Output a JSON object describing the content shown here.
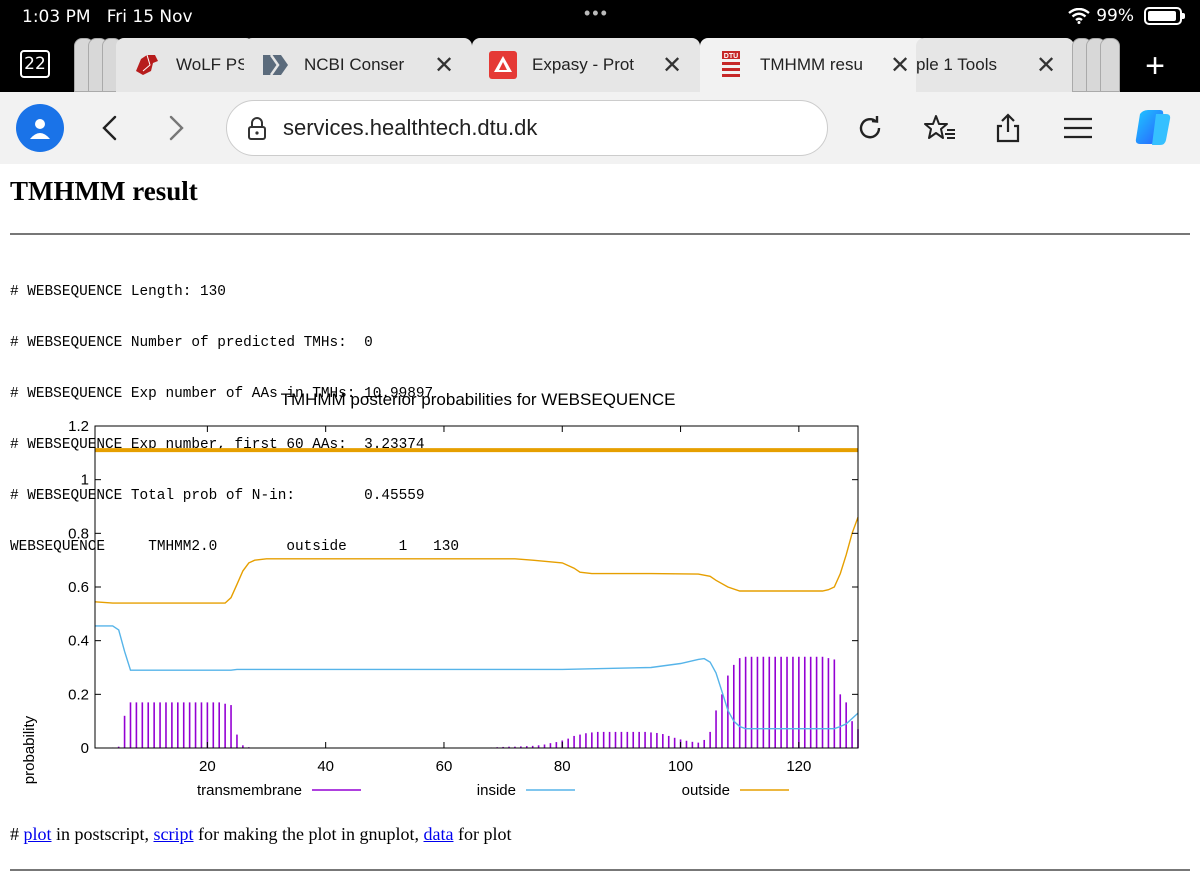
{
  "status_bar": {
    "time": "1:03 PM",
    "date": "Fri 15 Nov",
    "battery": "99%"
  },
  "tabs": {
    "count": "22",
    "items": [
      {
        "title": "WoLF PS",
        "icon": "wolf-icon"
      },
      {
        "title": "NCBI Conser",
        "icon": "ncbi-icon"
      },
      {
        "title": "Expasy - Prot",
        "icon": "expasy-icon"
      },
      {
        "title": "TMHMM resu",
        "icon": "dtu-icon",
        "active": true
      },
      {
        "title": "ple 1 Tools",
        "icon": ""
      }
    ],
    "close_glyph": "✕",
    "new_tab_glyph": "+"
  },
  "toolbar": {
    "url": "services.healthtech.dtu.dk"
  },
  "page": {
    "title": "TMHMM result",
    "output_lines": [
      "# WEBSEQUENCE Length: 130",
      "# WEBSEQUENCE Number of predicted TMHs:  0",
      "# WEBSEQUENCE Exp number of AAs in TMHs: 10.99897",
      "# WEBSEQUENCE Exp number, first 60 AAs:  3.23374",
      "# WEBSEQUENCE Total prob of N-in:        0.45559",
      "WEBSEQUENCE\tTMHMM2.0\toutside\t     1   130"
    ],
    "footer": {
      "prefix": "# ",
      "plot_link": "plot",
      "text1": " in postscript, ",
      "script_link": "script",
      "text2": " for making the plot in gnuplot, ",
      "data_link": "data",
      "text3": " for plot"
    }
  },
  "chart_data": {
    "type": "line",
    "title": "TMHMM posterior probabilities for WEBSEQUENCE",
    "xlabel": "",
    "ylabel": "probability",
    "xlim": [
      1,
      130
    ],
    "ylim": [
      0,
      1.2
    ],
    "x_ticks": [
      20,
      40,
      60,
      80,
      100,
      120
    ],
    "y_ticks": [
      "0",
      "0.2",
      "0.4",
      "0.6",
      "0.8",
      "1",
      "1.2"
    ],
    "grid": false,
    "legend_position": "bottom",
    "colors": {
      "transmembrane": "#9400d3",
      "inside": "#56b4e9",
      "outside": "#e69f00"
    },
    "series": [
      {
        "name": "transmembrane",
        "style": "impulses",
        "values": [
          [
            1,
            0.0
          ],
          [
            2,
            0.0
          ],
          [
            3,
            0.0
          ],
          [
            4,
            0.002
          ],
          [
            5,
            0.005
          ],
          [
            6,
            0.12
          ],
          [
            7,
            0.17
          ],
          [
            8,
            0.17
          ],
          [
            9,
            0.17
          ],
          [
            10,
            0.17
          ],
          [
            11,
            0.17
          ],
          [
            12,
            0.17
          ],
          [
            13,
            0.17
          ],
          [
            14,
            0.17
          ],
          [
            15,
            0.17
          ],
          [
            16,
            0.17
          ],
          [
            17,
            0.17
          ],
          [
            18,
            0.17
          ],
          [
            19,
            0.17
          ],
          [
            20,
            0.17
          ],
          [
            21,
            0.17
          ],
          [
            22,
            0.17
          ],
          [
            23,
            0.165
          ],
          [
            24,
            0.16
          ],
          [
            25,
            0.05
          ],
          [
            26,
            0.01
          ],
          [
            27,
            0.003
          ],
          [
            28,
            0.001
          ],
          [
            29,
            0.001
          ],
          [
            30,
            0.001
          ],
          [
            31,
            0.0
          ],
          [
            32,
            0.0
          ],
          [
            33,
            0.0
          ],
          [
            34,
            0.0
          ],
          [
            35,
            0.0
          ],
          [
            36,
            0.0
          ],
          [
            37,
            0.0
          ],
          [
            38,
            0.0
          ],
          [
            39,
            0.0
          ],
          [
            40,
            0.0
          ],
          [
            41,
            0.0
          ],
          [
            42,
            0.0
          ],
          [
            43,
            0.0
          ],
          [
            44,
            0.0
          ],
          [
            45,
            0.0
          ],
          [
            46,
            0.0
          ],
          [
            47,
            0.0
          ],
          [
            48,
            0.0
          ],
          [
            49,
            0.0
          ],
          [
            50,
            0.0
          ],
          [
            51,
            0.0
          ],
          [
            52,
            0.0
          ],
          [
            53,
            0.0
          ],
          [
            54,
            0.0
          ],
          [
            55,
            0.0
          ],
          [
            56,
            0.0
          ],
          [
            57,
            0.0
          ],
          [
            58,
            0.0
          ],
          [
            59,
            0.0
          ],
          [
            60,
            0.0
          ],
          [
            61,
            0.0
          ],
          [
            62,
            0.0
          ],
          [
            63,
            0.0
          ],
          [
            64,
            0.0
          ],
          [
            65,
            0.0
          ],
          [
            66,
            0.0
          ],
          [
            67,
            0.0
          ],
          [
            68,
            0.002
          ],
          [
            69,
            0.003
          ],
          [
            70,
            0.004
          ],
          [
            71,
            0.005
          ],
          [
            72,
            0.005
          ],
          [
            73,
            0.006
          ],
          [
            74,
            0.007
          ],
          [
            75,
            0.008
          ],
          [
            76,
            0.01
          ],
          [
            77,
            0.013
          ],
          [
            78,
            0.018
          ],
          [
            79,
            0.022
          ],
          [
            80,
            0.028
          ],
          [
            81,
            0.035
          ],
          [
            82,
            0.045
          ],
          [
            83,
            0.05
          ],
          [
            84,
            0.055
          ],
          [
            85,
            0.058
          ],
          [
            86,
            0.06
          ],
          [
            87,
            0.06
          ],
          [
            88,
            0.06
          ],
          [
            89,
            0.06
          ],
          [
            90,
            0.06
          ],
          [
            91,
            0.06
          ],
          [
            92,
            0.06
          ],
          [
            93,
            0.06
          ],
          [
            94,
            0.06
          ],
          [
            95,
            0.058
          ],
          [
            96,
            0.056
          ],
          [
            97,
            0.052
          ],
          [
            98,
            0.045
          ],
          [
            99,
            0.038
          ],
          [
            100,
            0.032
          ],
          [
            101,
            0.027
          ],
          [
            102,
            0.023
          ],
          [
            103,
            0.02
          ],
          [
            104,
            0.03
          ],
          [
            105,
            0.06
          ],
          [
            106,
            0.14
          ],
          [
            107,
            0.2
          ],
          [
            108,
            0.27
          ],
          [
            109,
            0.31
          ],
          [
            110,
            0.335
          ],
          [
            111,
            0.34
          ],
          [
            112,
            0.34
          ],
          [
            113,
            0.34
          ],
          [
            114,
            0.34
          ],
          [
            115,
            0.34
          ],
          [
            116,
            0.34
          ],
          [
            117,
            0.34
          ],
          [
            118,
            0.34
          ],
          [
            119,
            0.34
          ],
          [
            120,
            0.34
          ],
          [
            121,
            0.34
          ],
          [
            122,
            0.34
          ],
          [
            123,
            0.34
          ],
          [
            124,
            0.34
          ],
          [
            125,
            0.335
          ],
          [
            126,
            0.33
          ],
          [
            127,
            0.2
          ],
          [
            128,
            0.17
          ],
          [
            129,
            0.1
          ],
          [
            130,
            0.07
          ]
        ]
      },
      {
        "name": "inside",
        "style": "line",
        "values": [
          [
            1,
            0.455
          ],
          [
            4,
            0.455
          ],
          [
            5,
            0.44
          ],
          [
            6,
            0.36
          ],
          [
            7,
            0.29
          ],
          [
            24,
            0.29
          ],
          [
            25,
            0.293
          ],
          [
            40,
            0.293
          ],
          [
            80,
            0.293
          ],
          [
            95,
            0.3
          ],
          [
            100,
            0.315
          ],
          [
            103,
            0.33
          ],
          [
            104,
            0.333
          ],
          [
            105,
            0.32
          ],
          [
            106,
            0.28
          ],
          [
            107,
            0.21
          ],
          [
            108,
            0.14
          ],
          [
            109,
            0.1
          ],
          [
            110,
            0.08
          ],
          [
            111,
            0.072
          ],
          [
            126,
            0.072
          ],
          [
            127,
            0.08
          ],
          [
            128,
            0.09
          ],
          [
            129,
            0.11
          ],
          [
            130,
            0.13
          ]
        ]
      },
      {
        "name": "outside",
        "style": "line",
        "values": [
          [
            1,
            0.545
          ],
          [
            4,
            0.54
          ],
          [
            23,
            0.54
          ],
          [
            24,
            0.56
          ],
          [
            25,
            0.61
          ],
          [
            26,
            0.66
          ],
          [
            27,
            0.69
          ],
          [
            28,
            0.7
          ],
          [
            30,
            0.705
          ],
          [
            72,
            0.705
          ],
          [
            75,
            0.7
          ],
          [
            80,
            0.69
          ],
          [
            82,
            0.67
          ],
          [
            83,
            0.655
          ],
          [
            85,
            0.65
          ],
          [
            95,
            0.65
          ],
          [
            103,
            0.648
          ],
          [
            105,
            0.64
          ],
          [
            106,
            0.625
          ],
          [
            108,
            0.6
          ],
          [
            110,
            0.585
          ],
          [
            112,
            0.585
          ],
          [
            124,
            0.585
          ],
          [
            125,
            0.59
          ],
          [
            126,
            0.6
          ],
          [
            127,
            0.65
          ],
          [
            128,
            0.72
          ],
          [
            129,
            0.8
          ],
          [
            130,
            0.86
          ]
        ]
      },
      {
        "name": "",
        "style": "line",
        "values": [
          [
            1,
            1.11
          ],
          [
            130,
            1.11
          ]
        ]
      }
    ]
  }
}
